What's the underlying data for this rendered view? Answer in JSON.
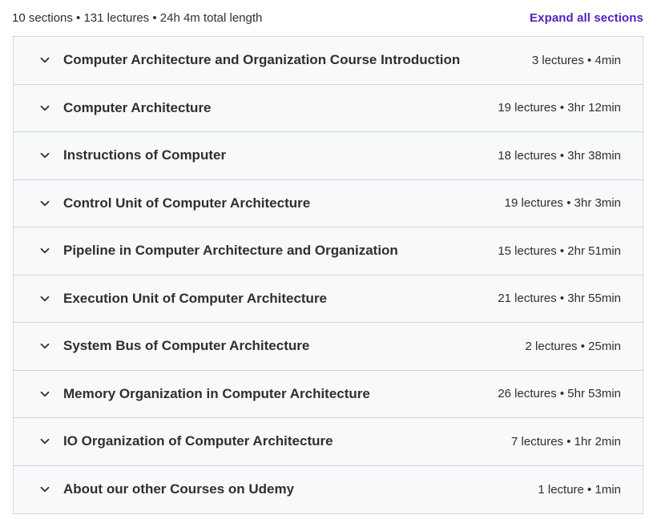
{
  "header": {
    "summary": "10 sections • 131 lectures • 24h 4m total length",
    "expand_label": "Expand all sections",
    "accent_color": "#5022c3"
  },
  "sections": [
    {
      "title": "Computer Architecture and Organization Course Introduction",
      "meta": "3 lectures • 4min"
    },
    {
      "title": "Computer Architecture",
      "meta": "19 lectures • 3hr 12min"
    },
    {
      "title": "Instructions of Computer",
      "meta": "18 lectures • 3hr 38min"
    },
    {
      "title": "Control Unit of Computer Architecture",
      "meta": "19 lectures • 3hr 3min"
    },
    {
      "title": "Pipeline in Computer Architecture and Organization",
      "meta": "15 lectures • 2hr 51min"
    },
    {
      "title": "Execution Unit of Computer Architecture",
      "meta": "21 lectures • 3hr 55min"
    },
    {
      "title": "System Bus of Computer Architecture",
      "meta": "2 lectures • 25min"
    },
    {
      "title": "Memory Organization in Computer Architecture",
      "meta": "26 lectures • 5hr 53min"
    },
    {
      "title": "IO Organization of Computer Architecture",
      "meta": "7 lectures • 1hr 2min"
    },
    {
      "title": "About our other Courses on Udemy",
      "meta": "1 lecture • 1min"
    }
  ],
  "icons": {
    "section_toggle": "chevron-down-icon"
  }
}
